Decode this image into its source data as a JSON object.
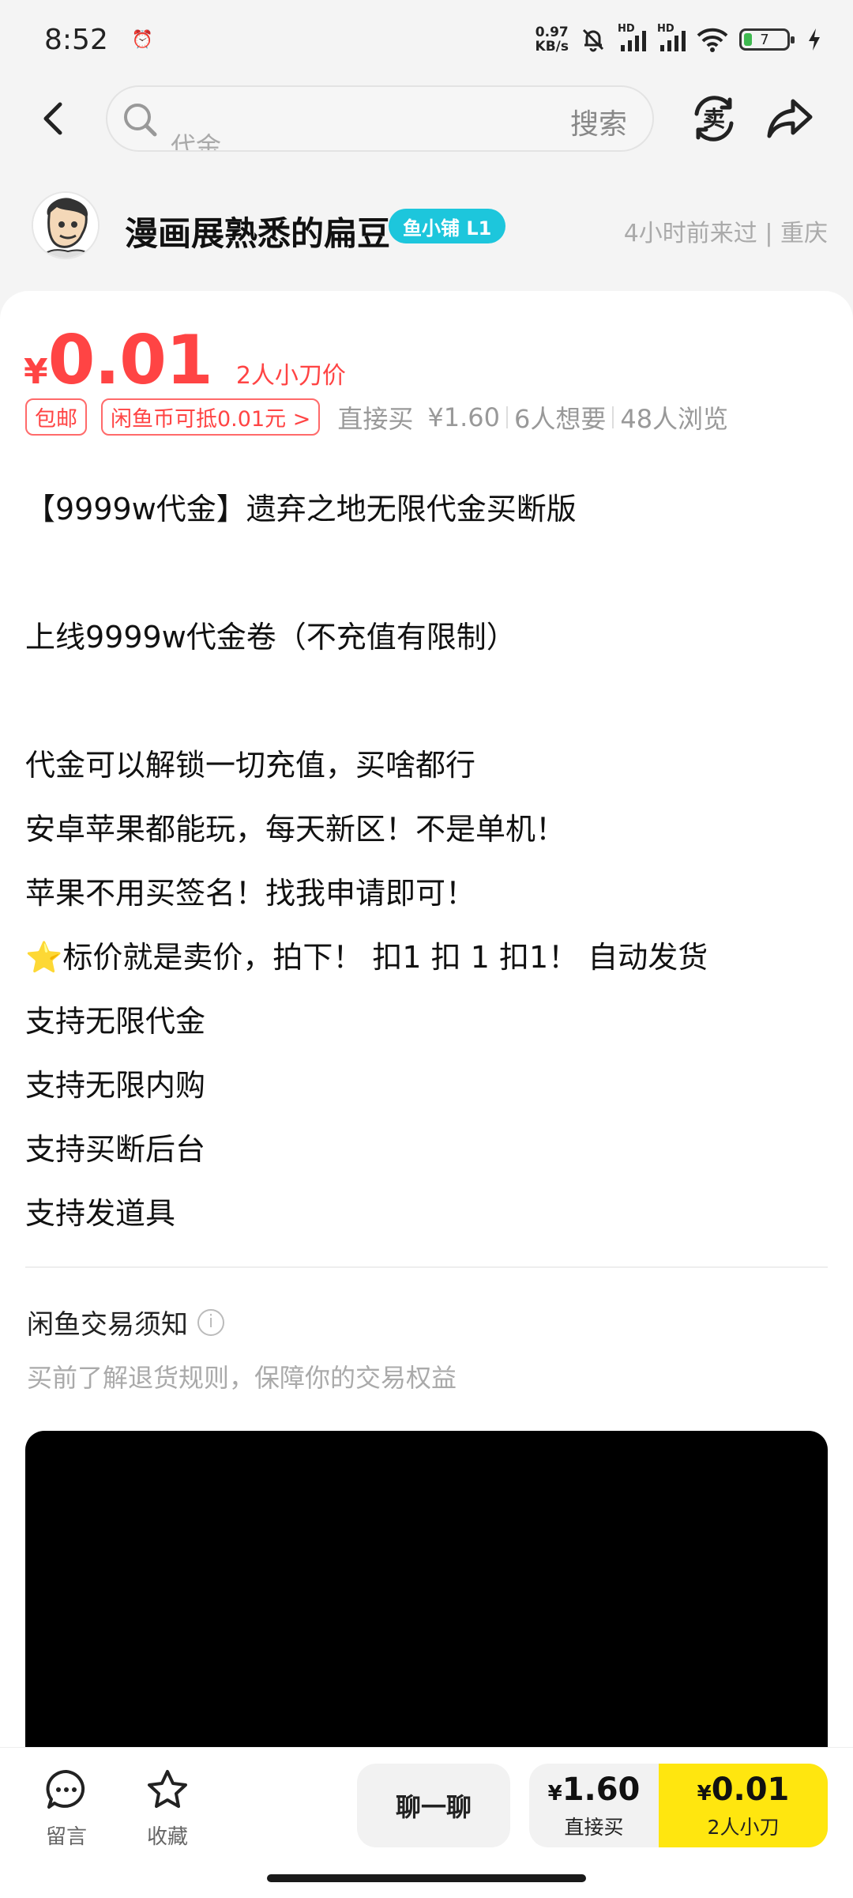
{
  "status_bar": {
    "time": "8:52",
    "net_speed_value": "0.97",
    "net_speed_unit": "KB/s",
    "hd1": "HD",
    "hd2": "HD",
    "battery_level": "7",
    "battery_color": "#3fb950"
  },
  "nav": {
    "search_placeholder": "代金",
    "search_button": "搜索",
    "sell_icon_text": "卖"
  },
  "seller": {
    "name": "漫画展熟悉的扁豆",
    "badge": "鱼小铺 L1",
    "last_seen": "4小时前来过 | 重庆"
  },
  "product": {
    "price_symbol": "¥",
    "price": "0.01",
    "price_note": "2人小刀价",
    "tag_shipping": "包邮",
    "tag_coin": "闲鱼币可抵0.01元 >",
    "direct_buy_label": "直接买",
    "direct_buy_price": "¥1.60",
    "want_count": "6人想要",
    "view_count": "48人浏览",
    "accent_color": "#ff4444",
    "description": {
      "l1": "【9999w代金】遗弃之地无限代金买断版",
      "l2": "上线9999w代金卷（不充值有限制）",
      "l3": "代金可以解锁一切充值，买啥都行",
      "l4": "安卓苹果都能玩，每天新区！不是单机！",
      "l5": "苹果不用买签名！找我申请即可！",
      "l6_star": "⭐",
      "l6": "标价就是卖价，拍下！ 扣1 扣 1 扣1！ 自动发货",
      "l7": "支持无限代金",
      "l8": "支持无限内购",
      "l9": "支持买断后台",
      "l10": "支持发道具"
    }
  },
  "notice": {
    "title": "闲鱼交易须知",
    "subtitle": "买前了解退货规则，保障你的交易权益"
  },
  "bottom_bar": {
    "comment_label": "留言",
    "favorite_label": "收藏",
    "chat_label": "聊一聊",
    "direct_symbol": "¥",
    "direct_price": "1.60",
    "direct_label": "直接买",
    "bargain_symbol": "¥",
    "bargain_price": "0.01",
    "bargain_label": "2人小刀",
    "bargain_color": "#ffe60f"
  }
}
